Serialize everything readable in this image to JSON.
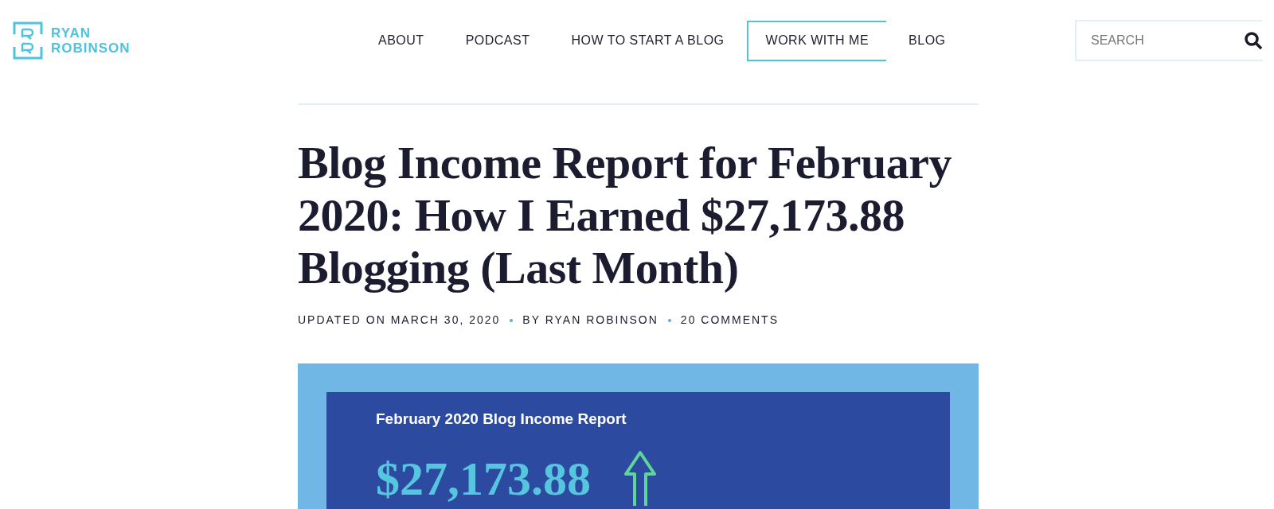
{
  "logo": {
    "line_1": "RYAN",
    "line_2": "ROBINSON"
  },
  "nav": [
    {
      "label": "ABOUT",
      "selected": false
    },
    {
      "label": "PODCAST",
      "selected": false
    },
    {
      "label": "HOW TO START A BLOG",
      "selected": false
    },
    {
      "label": "WORK WITH ME",
      "selected": true
    },
    {
      "label": "BLOG",
      "selected": false
    }
  ],
  "search": {
    "placeholder": "SEARCH"
  },
  "article": {
    "title": "Blog Income Report for February 2020: How I Earned $27,173.88 Blogging (Last Month)",
    "meta": [
      "UPDATED ON MARCH 30, 2020",
      "BY RYAN ROBINSON",
      "20 COMMENTS"
    ],
    "featured_image": {
      "heading": "February 2020 Blog Income Report",
      "amount": "$27,173.88"
    }
  }
}
